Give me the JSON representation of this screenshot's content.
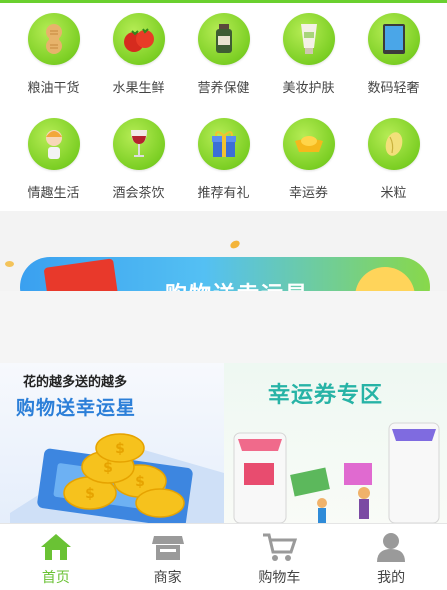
{
  "categories": [
    {
      "label": "粮油干货",
      "icon": "peanut-icon"
    },
    {
      "label": "水果生鲜",
      "icon": "tomato-icon"
    },
    {
      "label": "营养保健",
      "icon": "supplement-bottle-icon"
    },
    {
      "label": "美妆护肤",
      "icon": "cosmetic-tube-icon"
    },
    {
      "label": "数码轻奢",
      "icon": "tablet-icon"
    },
    {
      "label": "情趣生活",
      "icon": "girl-avatar-icon"
    },
    {
      "label": "酒会茶饮",
      "icon": "wine-glass-icon"
    },
    {
      "label": "推荐有礼",
      "icon": "gift-box-icon"
    },
    {
      "label": "幸运券",
      "icon": "gold-ingot-icon"
    },
    {
      "label": "米粒",
      "icon": "rice-grain-icon"
    }
  ],
  "banner": {
    "text": "购物送幸运星"
  },
  "promos": {
    "left": {
      "line1": "花的越多送的越多",
      "line2": "购物送幸运星"
    },
    "right": {
      "title": "幸运券专区"
    }
  },
  "tabbar": {
    "items": [
      {
        "label": "首页",
        "icon": "home-icon",
        "active": true
      },
      {
        "label": "商家",
        "icon": "store-icon",
        "active": false
      },
      {
        "label": "购物车",
        "icon": "cart-icon",
        "active": false
      },
      {
        "label": "我的",
        "icon": "person-icon",
        "active": false
      }
    ]
  },
  "colors": {
    "accent": "#6ac234",
    "category_circle": "#7ccf24",
    "promo_blue": "#2c7fd8",
    "promo_teal": "#27b3a6"
  }
}
